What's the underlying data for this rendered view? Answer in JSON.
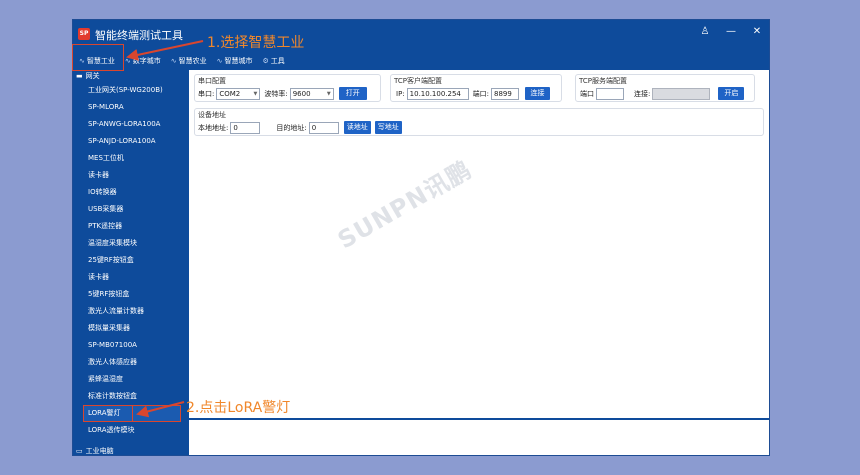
{
  "app": {
    "title": "智能终端测试工具",
    "logo_text": "SP",
    "window_controls": [
      "♙",
      "—",
      "✕"
    ]
  },
  "menu": {
    "items": [
      {
        "label": "智慧工业",
        "icon": "pulse-icon"
      },
      {
        "label": "数字城市",
        "icon": "pulse-icon"
      },
      {
        "label": "智慧农业",
        "icon": "pulse-icon"
      },
      {
        "label": "智慧城市",
        "icon": "pulse-icon"
      },
      {
        "label": "工具",
        "icon": "gear-icon"
      }
    ]
  },
  "sidebar": {
    "group_label": "网关",
    "items": [
      "工业网关(SP-WG200B)",
      "SP-MLORA",
      "SP-ANWG-LORA100A",
      "SP-ANJD-LORA100A",
      "MES工位机",
      "读卡器",
      "IO转换器",
      "USB采集器",
      "PTK遥控器",
      "温湿度采集模块",
      "25键RF按钮盒",
      "读卡器",
      "5键RF按钮盒",
      "激光人流量计数器",
      "模拟量采集器",
      "SP-MB07100A",
      "激光人体感应器",
      "紧蜂温湿度",
      "标准计数按钮盒",
      "LORA警灯",
      "LORA透传模块"
    ],
    "selected_index": 19,
    "bottom_label": "工业电脑"
  },
  "serial": {
    "title": "串口配置",
    "port_label": "串口:",
    "port_value": "COM2",
    "baud_label": "波特率:",
    "baud_value": "9600",
    "open_button": "打开"
  },
  "tcp_client": {
    "title": "TCP客户端配置",
    "ip_label": "IP:",
    "ip_value": "10.10.100.254",
    "port_label": "端口:",
    "port_value": "8899",
    "connect_button": "连接"
  },
  "tcp_server": {
    "title": "TCP服务端配置",
    "port_label": "端口",
    "port_value": "",
    "connect_label": "连接:",
    "connect_value": "",
    "start_button": "开启"
  },
  "device_address": {
    "title": "设备地址",
    "local_label": "本地地址:",
    "local_value": "0",
    "target_label": "目的地址:",
    "target_value": "0",
    "read_button": "读地址",
    "write_button": "写地址"
  },
  "watermark": "SUNPN讯鹏",
  "annotations": {
    "step1": "1.选择智慧工业",
    "step2": "2.点击LoRA警灯",
    "color": "#f0872b",
    "box_color": "#d9462e"
  },
  "colors": {
    "primary": "#0e4b9b",
    "button": "#1f63c6",
    "desktop": "#8b9bd0"
  }
}
